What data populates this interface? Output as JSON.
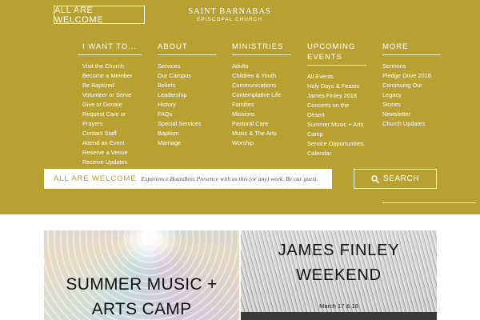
{
  "header": {
    "welcome_button": "ALL ARE WELCOME",
    "brand_name": "SAINT BARNABAS",
    "brand_sub": "EPISCOPAL CHURCH"
  },
  "menu": [
    {
      "heading": "I WANT TO...",
      "items": [
        "Visit the Church",
        "Become a Member",
        "Be Baptized",
        "Volunteer or Serve",
        "Give or Donate",
        "Request Care or",
        "Prayers",
        "Contact Staff",
        "Attend an Event",
        "Reserve a Venue",
        "Receive Updates"
      ]
    },
    {
      "heading": "ABOUT",
      "items": [
        "Services",
        "Our Campus",
        "Beliefs",
        "Leadership",
        "History",
        "FAQs",
        "Special Services",
        "Baptism",
        "Marriage"
      ]
    },
    {
      "heading": "MINISTRIES",
      "items": [
        "Adults",
        "Children & Youth",
        "Communications",
        "Contemplative Life",
        "Families",
        "Missions",
        "Pastoral Care",
        "Music & The Arts",
        "Worship"
      ]
    },
    {
      "heading_line1": "UPCOMING",
      "heading_line2": "EVENTS",
      "items": [
        "All Events",
        "Holy Days & Feasts",
        "James Finley 2018",
        "Concerts on the",
        "Desert",
        "Summer Music + Arts",
        "Camp",
        "Service Opportunities",
        "Calendar"
      ]
    },
    {
      "heading": "MORE",
      "items": [
        "Sermons",
        "Pledge Drive 2018",
        "Continuing Our",
        "Legacy",
        "Stories",
        "Newsletter",
        "Church Updates"
      ]
    }
  ],
  "search": {
    "label": "ALL ARE WELCOME",
    "placeholder": "Experience Boundless Presence with us this (or any) week. Be our guest.",
    "button_label": "SEARCH"
  },
  "features": [
    {
      "title_line1": "SUMMER MUSIC +",
      "title_line2": "ARTS CAMP"
    },
    {
      "title_line1": "JAMES FINLEY",
      "title_line2": "WEEKEND",
      "date": "March 17 & 18"
    }
  ],
  "colors": {
    "brand_gold": "#b8a032",
    "text_light": "#ffffff"
  }
}
